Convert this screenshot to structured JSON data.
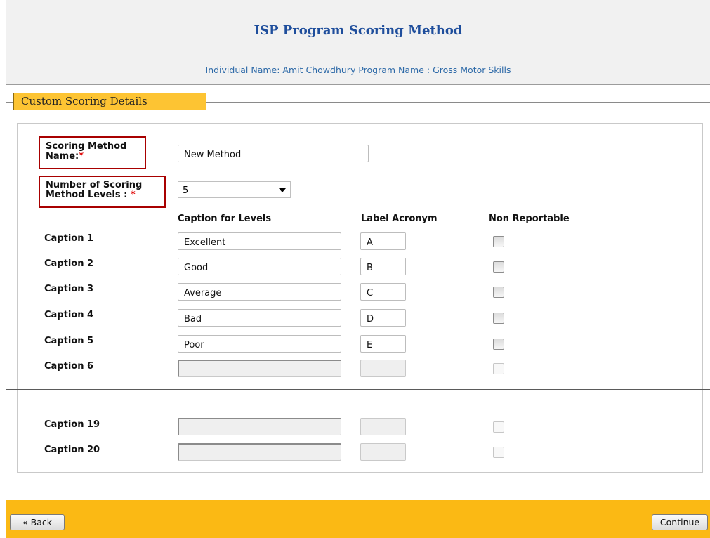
{
  "header": {
    "title": "ISP Program Scoring Method",
    "subtitle": "Individual Name: Amit Chowdhury  Program Name : Gross Motor Skills"
  },
  "section": {
    "legend": "Custom Scoring Details"
  },
  "form": {
    "method_name_label_1": "Scoring Method",
    "method_name_label_2": "Name:",
    "method_name_value": "New Method",
    "levels_label_1": "Number of Scoring",
    "levels_label_2": "Method Levels :",
    "levels_value": "5",
    "required_marker": "*"
  },
  "columns": {
    "caption": "Caption for Levels",
    "acronym": "Label Acronym",
    "non_reportable": "Non Reportable"
  },
  "captions": [
    {
      "label": "Caption 1",
      "value": "Excellent",
      "acronym": "A"
    },
    {
      "label": "Caption 2",
      "value": "Good",
      "acronym": "B"
    },
    {
      "label": "Caption 3",
      "value": "Average",
      "acronym": "C"
    },
    {
      "label": "Caption 4",
      "value": "Bad",
      "acronym": "D"
    },
    {
      "label": "Caption 5",
      "value": "Poor",
      "acronym": "E"
    },
    {
      "label": "Caption 6",
      "value": "",
      "acronym": ""
    },
    {
      "label": "Caption 19",
      "value": "",
      "acronym": ""
    },
    {
      "label": "Caption 20",
      "value": "",
      "acronym": ""
    }
  ],
  "footer": {
    "back_label": "« Back",
    "continue_label": "Continue"
  },
  "colors": {
    "title": "#1f4e9c",
    "subtitle": "#2e6aa8",
    "footer": "#fbb914",
    "legend": "#fdc433",
    "required": "#a80000"
  }
}
